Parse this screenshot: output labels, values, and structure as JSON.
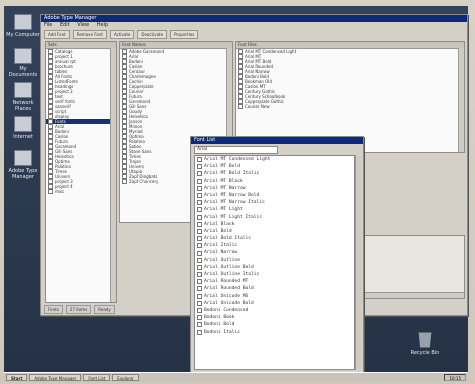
{
  "desktop_icons": [
    {
      "label": "My Computer",
      "icon": "computer-icon"
    },
    {
      "label": "My Documents",
      "icon": "documents-icon"
    },
    {
      "label": "Network Places",
      "icon": "network-icon"
    },
    {
      "label": "Internet",
      "icon": "globe-icon"
    },
    {
      "label": "Adobe Type Manager",
      "icon": "type-manager-icon"
    }
  ],
  "main_window": {
    "title": "Adobe Type Manager",
    "menu": [
      "File",
      "Edit",
      "View",
      "Help"
    ],
    "toolbar": [
      "Add Font",
      "Remove Font",
      "Activate",
      "Deactivate",
      "Properties"
    ],
    "left_pane": {
      "header": "Sets",
      "items": [
        {
          "label": "Catalogs",
          "selected": false
        },
        {
          "label": "project 1",
          "selected": false
        },
        {
          "label": "annual rpt",
          "selected": false
        },
        {
          "label": "brochure",
          "selected": false
        },
        {
          "label": "tables",
          "selected": false
        },
        {
          "label": "All Fonts",
          "selected": false
        },
        {
          "label": "ListedFonts",
          "selected": false
        },
        {
          "label": "headings",
          "selected": false
        },
        {
          "label": "project 2",
          "selected": false
        },
        {
          "label": "text",
          "selected": false
        },
        {
          "label": "serif fonts",
          "selected": false
        },
        {
          "label": "sanserif",
          "selected": false
        },
        {
          "label": "script",
          "selected": false
        },
        {
          "label": "display",
          "selected": false
        },
        {
          "label": "Fonts",
          "selected": true
        },
        {
          "label": "Arial",
          "selected": false
        },
        {
          "label": "Bodoni",
          "selected": false
        },
        {
          "label": "Caslon",
          "selected": false
        },
        {
          "label": "Futura",
          "selected": false
        },
        {
          "label": "Garamond",
          "selected": false
        },
        {
          "label": "Gill Sans",
          "selected": false
        },
        {
          "label": "Helvetica",
          "selected": false
        },
        {
          "label": "Optima",
          "selected": false
        },
        {
          "label": "Palatino",
          "selected": false
        },
        {
          "label": "Times",
          "selected": false
        },
        {
          "label": "Univers",
          "selected": false
        },
        {
          "label": "project 3",
          "selected": false
        },
        {
          "label": "project 4",
          "selected": false
        },
        {
          "label": "misc",
          "selected": false
        }
      ]
    },
    "middle_pane": {
      "header": "Font Names",
      "items": [
        "Adobe Garamond",
        "Arial",
        "Bodoni",
        "Caslon",
        "Centaur",
        "Charlemagne",
        "Cochin",
        "Copperplate",
        "Courier",
        "Futura",
        "Garamond",
        "Gill Sans",
        "Goudy",
        "Helvetica",
        "Janson",
        "Minion",
        "Myriad",
        "Optima",
        "Palatino",
        "Sabon",
        "Stone Sans",
        "Times",
        "Trajan",
        "Univers",
        "Utopia",
        "Zapf Dingbats",
        "Zapf Chancery"
      ]
    },
    "right_pane": {
      "header": "Font Files",
      "items": [
        "Arial MT Condensed Light",
        "Arial MT",
        "Arial MT Bold",
        "Arial Rounded",
        "Arial Narrow",
        "Bodoni Bold",
        "Bookman Old",
        "Caslon MT",
        "Century Gothic",
        "Century Schoolbook",
        "Copperplate Gothic",
        "Courier New"
      ]
    },
    "status": [
      "Fonts",
      "27 items",
      "Ready"
    ]
  },
  "popup_window": {
    "title": "Font List",
    "search_value": "Arial",
    "items": [
      "Arial MT Condensed Light",
      "Arial MT Bold",
      "Arial MT Bold Italic",
      "Arial MT Black",
      "Arial MT Narrow",
      "Arial MT Narrow Bold",
      "Arial MT Narrow Italic",
      "Arial MT Light",
      "Arial MT Light Italic",
      "Arial Black",
      "Arial Bold",
      "Arial Bold Italic",
      "Arial Italic",
      "Arial Narrow",
      "Arial Outline",
      "Arial Outline Bold",
      "Arial Outline Italic",
      "Arial Rounded MT",
      "Arial Rounded Bold",
      "Arial Unicode MS",
      "Arial Unicode Bold",
      "Bodoni Condensed",
      "Bodoni Book",
      "Bodoni Bold",
      "Bodoni Italic"
    ]
  },
  "recycle_bin": {
    "label": "Recycle Bin",
    "icon": "recycle-bin-icon"
  },
  "taskbar": {
    "start": "Start",
    "tasks": [
      "Adobe Type Manager",
      "Font List",
      "Explorer"
    ],
    "clock": "10:15"
  }
}
